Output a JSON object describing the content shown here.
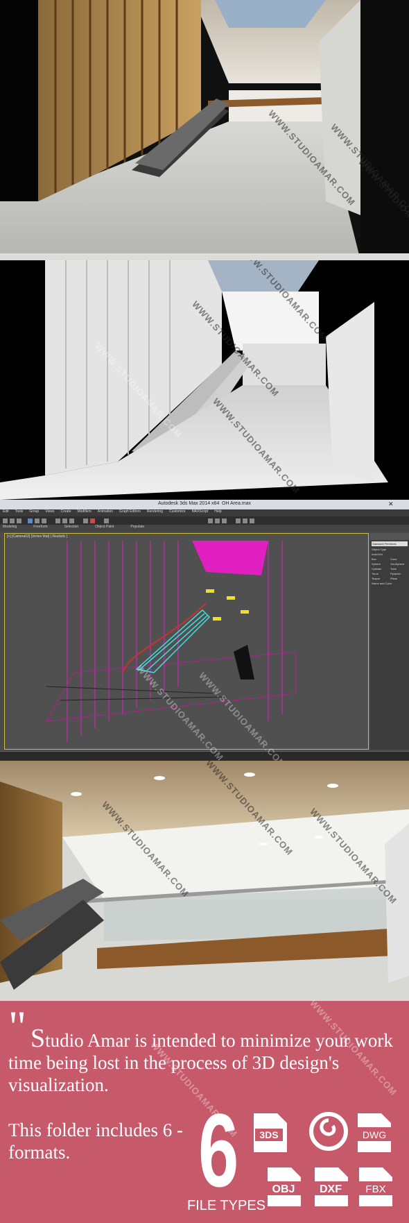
{
  "watermark": "WWW.STUDIOAMAR.COM",
  "max_window": {
    "title": "Autodesk 3ds Max 2014 x64",
    "file": "OH Area.max",
    "viewport_label": "[+] [Camera03] [Vertex Mat] [ Realistic ]",
    "menu_items": [
      "Edit",
      "Tools",
      "Group",
      "Views",
      "Create",
      "Modifiers",
      "Animation",
      "Graph Editors",
      "Rendering",
      "Customize",
      "MAXScript",
      "Help"
    ],
    "ribbon_tabs": [
      "Modeling",
      "Freeform",
      "Selection",
      "Object Paint",
      "Populate"
    ],
    "panel_items": [
      "Standard Primitives",
      "Object Type",
      "AutoGrid",
      "Box",
      "Cone",
      "Sphere",
      "GeoSphere",
      "Cylinder",
      "Tube",
      "Torus",
      "Pyramid",
      "Teapot",
      "Plane",
      "Name and Color"
    ]
  },
  "promo": {
    "quote_mark": "\"",
    "slogan_first": "S",
    "slogan_rest": "tudio Amar is intended to minimize your work time being lost in the process of 3D design's visualization.",
    "folder_text": "This folder includes 6 - formats.",
    "count": "6",
    "count_caption": "FILE TYPES",
    "formats": [
      "3DS",
      "MAX",
      "DWG",
      "OBJ",
      "DXF",
      "FBX"
    ]
  },
  "colors": {
    "promo_bg": "#c65a6b",
    "wireframe_magenta": "#e020c0",
    "wireframe_cyan": "#40e0e0",
    "wireframe_yellow": "#f0e020"
  }
}
